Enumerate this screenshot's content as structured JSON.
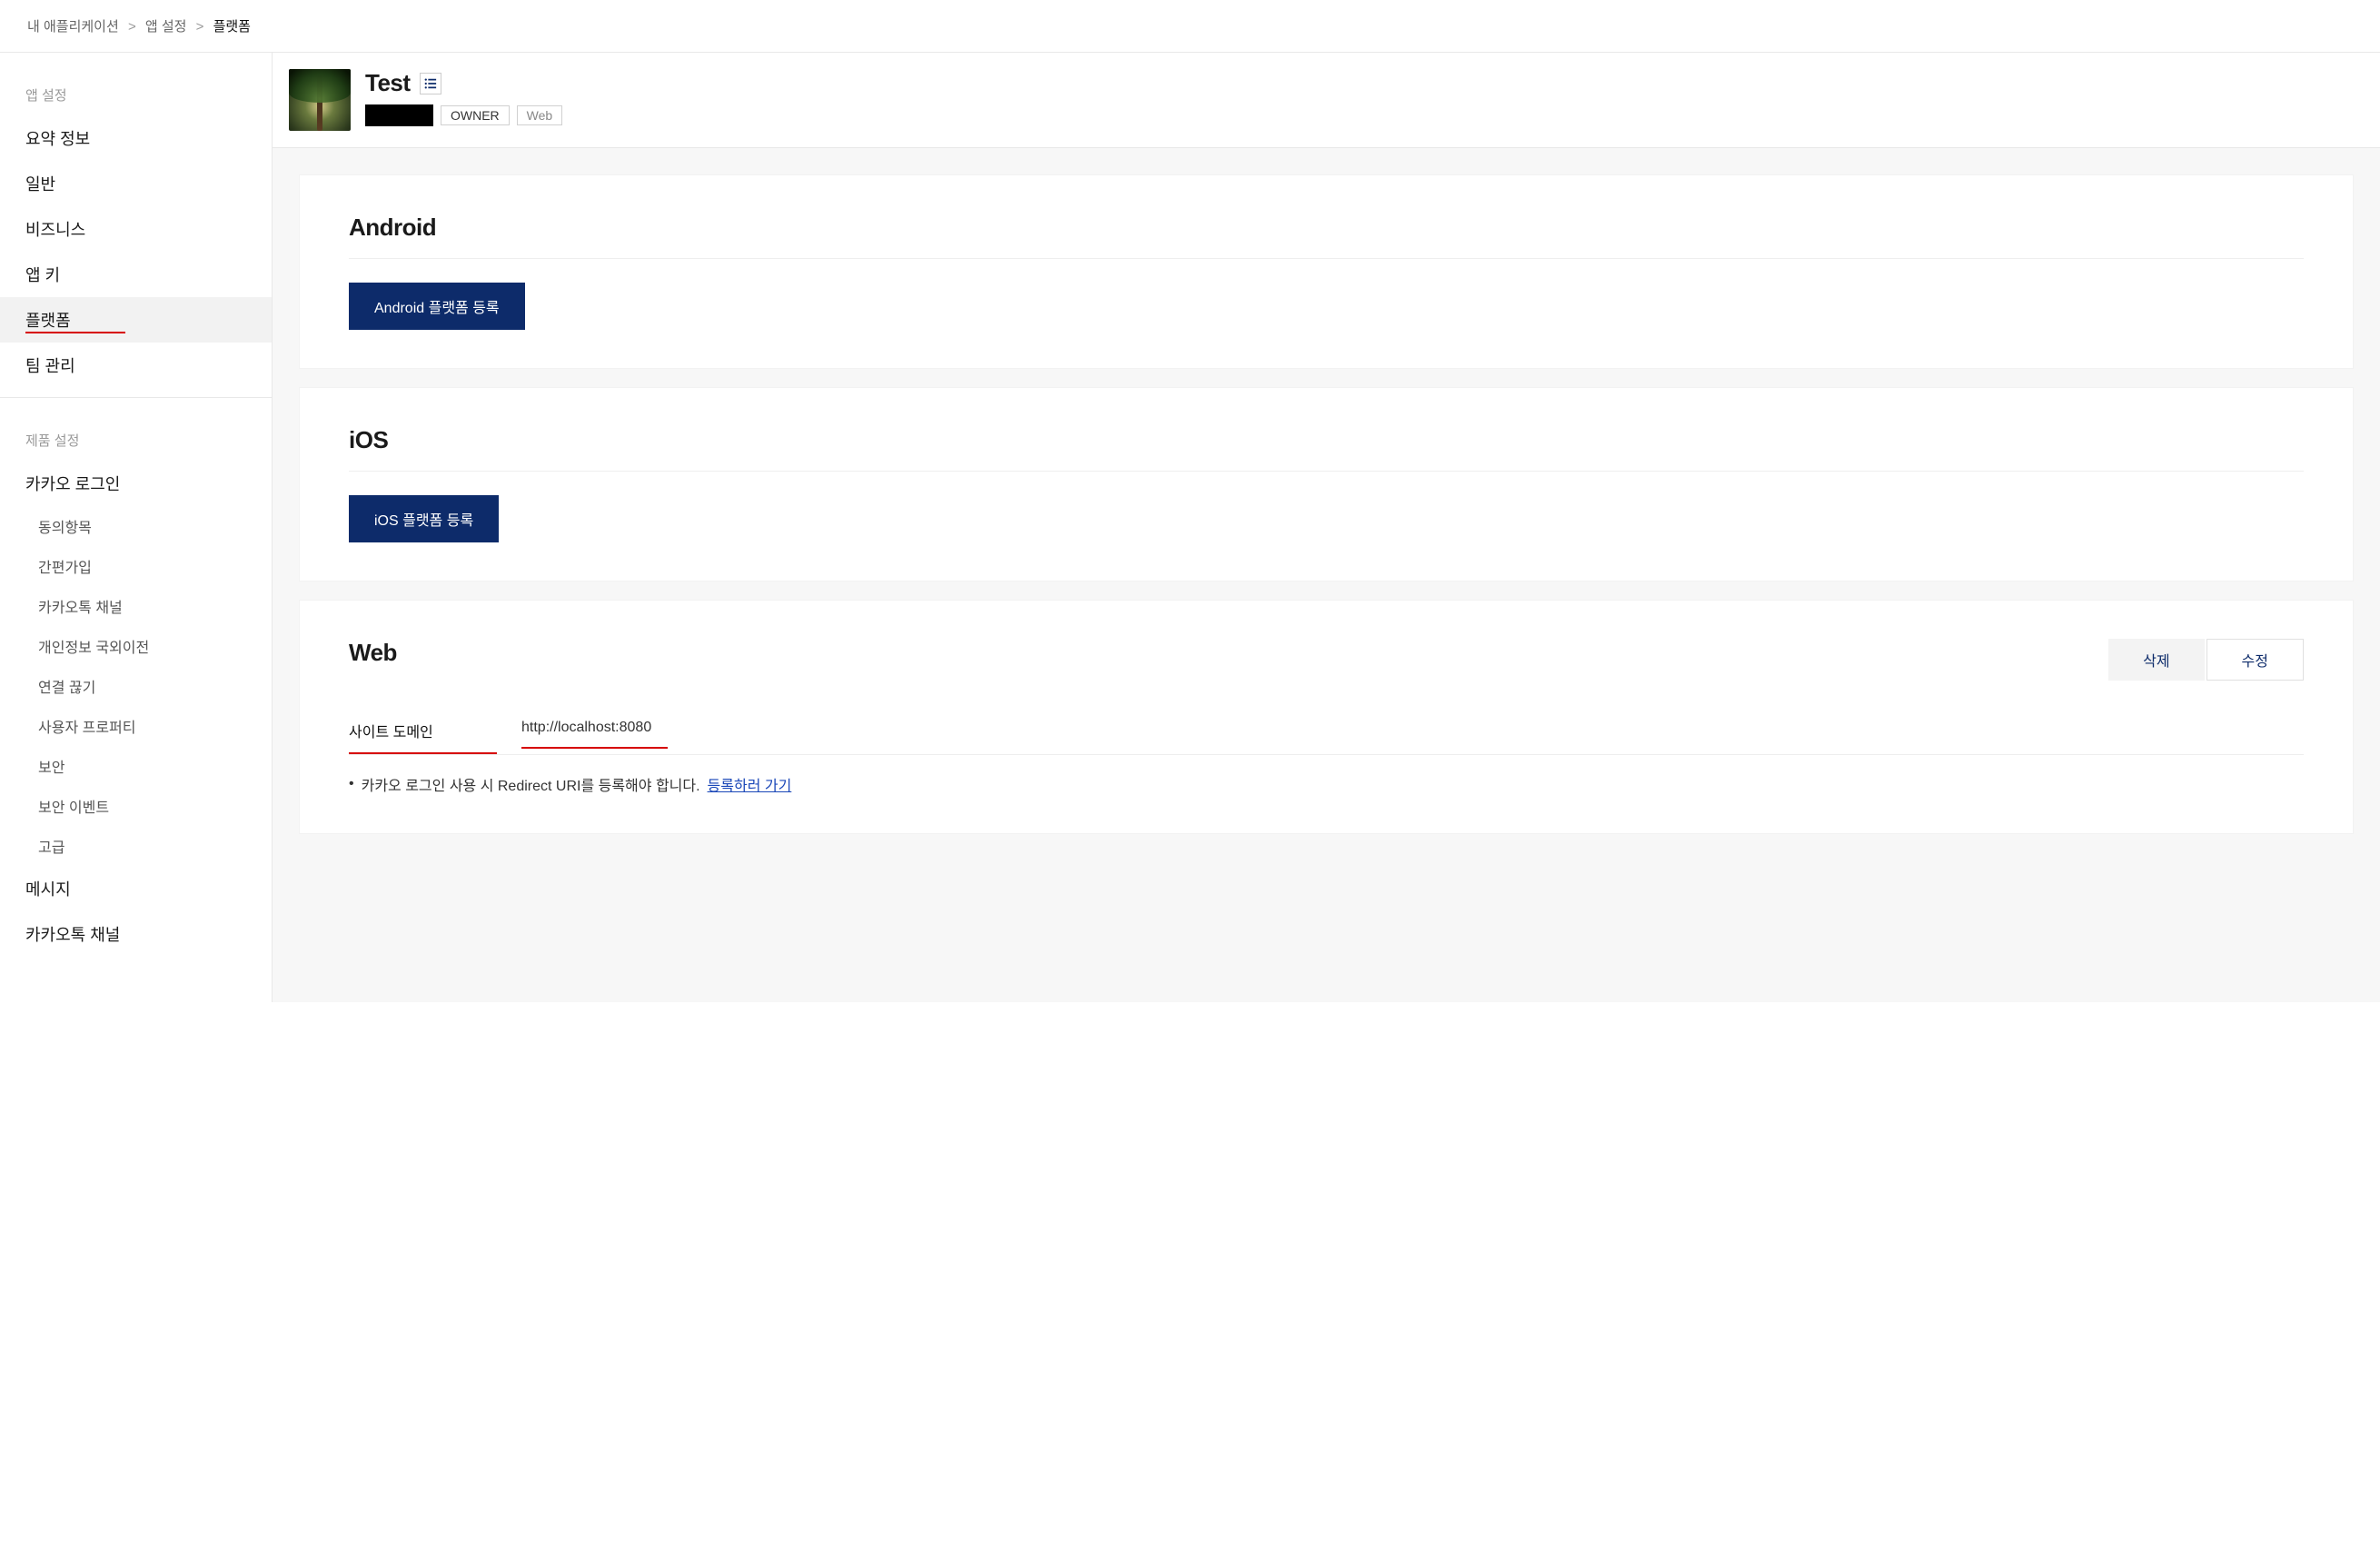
{
  "breadcrumb": {
    "items": [
      "내 애플리케이션",
      "앱 설정"
    ],
    "current": "플랫폼",
    "sep": ">"
  },
  "sidebar": {
    "groups": [
      {
        "header": "앱 설정",
        "items": [
          {
            "label": "요약 정보",
            "active": false
          },
          {
            "label": "일반",
            "active": false
          },
          {
            "label": "비즈니스",
            "active": false
          },
          {
            "label": "앱 키",
            "active": false
          },
          {
            "label": "플랫폼",
            "active": true,
            "underline": true
          },
          {
            "label": "팀 관리",
            "active": false
          }
        ]
      },
      {
        "header": "제품 설정",
        "items": [
          {
            "label": "카카오 로그인",
            "active": false,
            "subitems": [
              "동의항목",
              "간편가입",
              "카카오톡 채널",
              "개인정보 국외이전",
              "연결 끊기",
              "사용자 프로퍼티",
              "보안",
              "보안 이벤트",
              "고급"
            ]
          },
          {
            "label": "메시지",
            "active": false
          },
          {
            "label": "카카오톡 채널",
            "active": false
          }
        ]
      }
    ]
  },
  "appHeader": {
    "title": "Test",
    "ownerTag": "OWNER",
    "webTag": "Web"
  },
  "sections": {
    "android": {
      "title": "Android",
      "button": "Android 플랫폼 등록"
    },
    "ios": {
      "title": "iOS",
      "button": "iOS 플랫폼 등록"
    },
    "web": {
      "title": "Web",
      "deleteBtn": "삭제",
      "editBtn": "수정",
      "domainLabel": "사이트 도메인",
      "domainValue": "http://localhost:8080",
      "note": "카카오 로그인 사용 시 Redirect URI를 등록해야 합니다.",
      "noteLink": "등록하러 가기"
    }
  }
}
